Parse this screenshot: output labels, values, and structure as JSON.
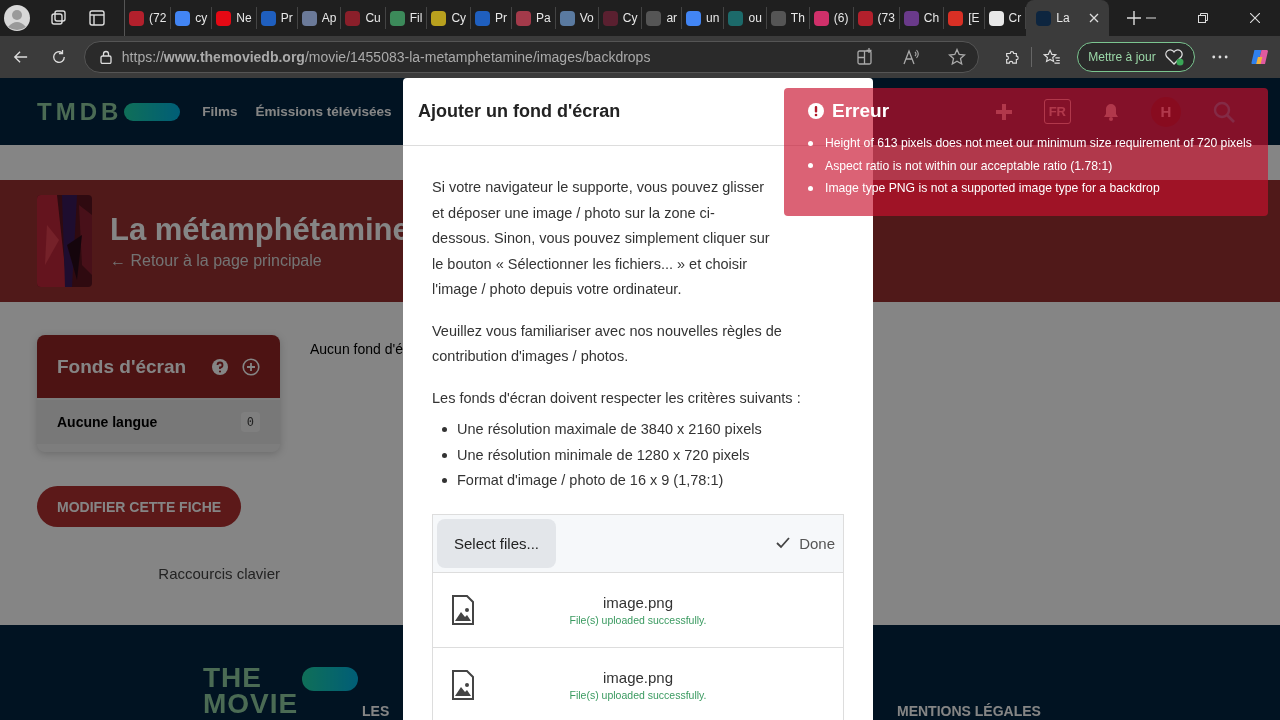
{
  "browser": {
    "tabs": [
      {
        "label": "(72",
        "color": "#b3202c",
        "selected": false
      },
      {
        "label": "cy",
        "color": "#4285f4",
        "selected": false
      },
      {
        "label": "Ne",
        "color": "#e50914",
        "selected": false
      },
      {
        "label": "Pr",
        "color": "#1f5fbf",
        "selected": false
      },
      {
        "label": "Ap",
        "color": "#6b7a99",
        "selected": false
      },
      {
        "label": "Cu",
        "color": "#8a1f2a",
        "selected": false
      },
      {
        "label": "Fil",
        "color": "#3c8a5a",
        "selected": false
      },
      {
        "label": "Cy",
        "color": "#b8a01e",
        "selected": false
      },
      {
        "label": "Pr",
        "color": "#1f5fbf",
        "selected": false
      },
      {
        "label": "Pa",
        "color": "#a33a4a",
        "selected": false
      },
      {
        "label": "Vo",
        "color": "#5a7aa0",
        "selected": false
      },
      {
        "label": "Cy",
        "color": "#5a2030",
        "selected": false
      },
      {
        "label": "ar",
        "color": "#555555",
        "selected": false
      },
      {
        "label": "un",
        "color": "#4285f4",
        "selected": false
      },
      {
        "label": "ou",
        "color": "#1c6a6a",
        "selected": false
      },
      {
        "label": "Th",
        "color": "#555555",
        "selected": false
      },
      {
        "label": "(6)",
        "color": "#d0306a",
        "selected": false
      },
      {
        "label": "(73",
        "color": "#b3202c",
        "selected": false
      },
      {
        "label": "Ch",
        "color": "#6a3a8a",
        "selected": false
      },
      {
        "label": "[E",
        "color": "#d93025",
        "selected": false
      },
      {
        "label": "Cr",
        "color": "#e8e8e8",
        "selected": false
      },
      {
        "label": "La",
        "color": "#0d253f",
        "selected": true
      }
    ],
    "url": "https://**www.themoviedb.org**/movie/1455083-la-metamphetamine/images/backdrops",
    "update_button": "Mettre à jour"
  },
  "header": {
    "logo": "TMDB",
    "nav": [
      "Films",
      "Émissions télévisées"
    ],
    "language": "FR",
    "avatar": "H"
  },
  "hero": {
    "title": "La métamphétamine",
    "back_link": "← Retour à la page principale"
  },
  "sidebar": {
    "title": "Fonds d'écran",
    "items": [
      {
        "label": "Aucune langue",
        "count": "0"
      }
    ]
  },
  "empty_message": "Aucun fond d'é",
  "edit_button": "MODIFIER CETTE FICHE",
  "shortcuts_link": "Raccourcis clavier",
  "footer": {
    "logo": [
      "THE",
      "MOVIE"
    ],
    "headings": [
      "LES",
      "MENTIONS LÉGALES"
    ]
  },
  "modal": {
    "title": "Ajouter un fond d'écran",
    "paragraphs": [
      "Si votre navigateur le supporte, vous pouvez glisser et déposer une image / photo sur la zone ci-dessous. Sinon, vous pouvez simplement cliquer sur le bouton « Sélectionner les fichiers... » et choisir l'image / photo depuis votre ordinateur.",
      "Veuillez vous familiariser avec nos nouvelles règles de contribution d'images / photos.",
      "Les fonds d'écran doivent respecter les critères suivants :"
    ],
    "criteria": [
      "Une résolution maximale de 3840 x 2160 pixels",
      "Une résolution minimale de 1280 x 720 pixels",
      "Format d'image / photo de 16 x 9 (1,78:1)"
    ],
    "uploader": {
      "select_button": "Select files...",
      "status": "Done",
      "files": [
        {
          "name": "image.png",
          "status": "File(s) uploaded successfully."
        },
        {
          "name": "image.png",
          "status": "File(s) uploaded successfully."
        }
      ]
    }
  },
  "error": {
    "title": "Erreur",
    "messages": [
      "Height of 613 pixels does not meet our minimum size requirement of 720 pixels",
      "Aspect ratio is not within our acceptable ratio (1.78:1)",
      "Image type PNG is not a supported image type for a backdrop"
    ]
  }
}
